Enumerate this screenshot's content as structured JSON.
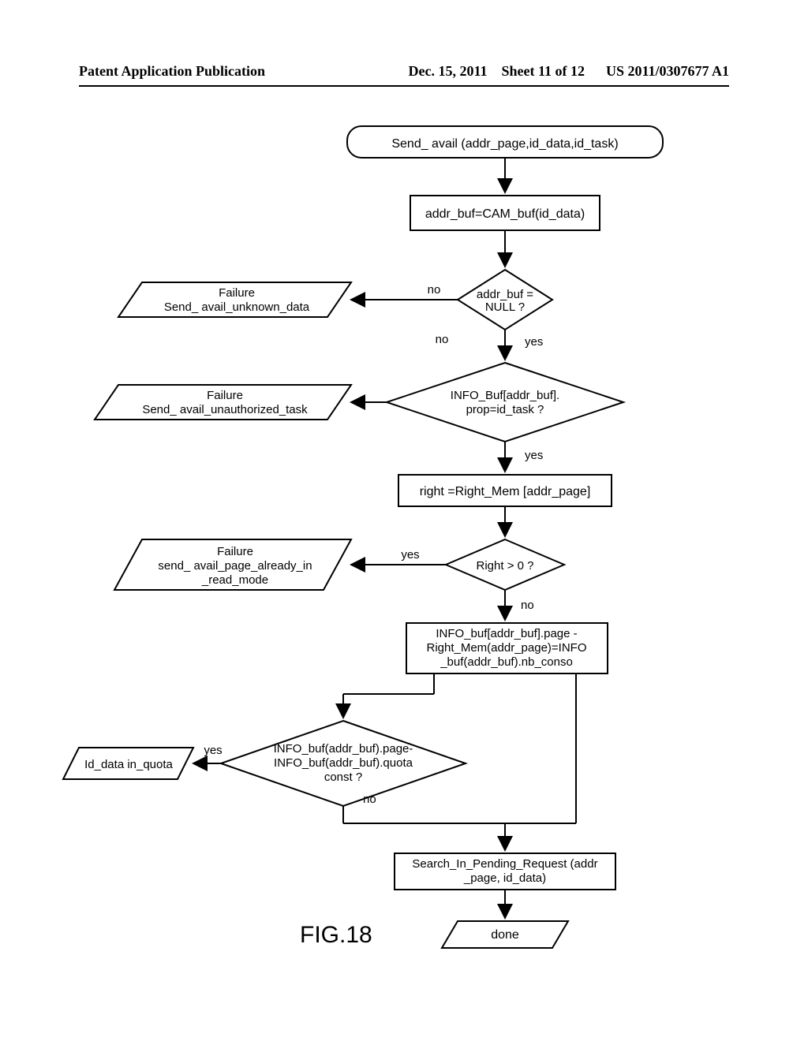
{
  "header": {
    "left": "Patent Application Publication",
    "date": "Dec. 15, 2011",
    "sheet": "Sheet 11 of 12",
    "pubno": "US 2011/0307677 A1"
  },
  "figure_label": "FIG.18",
  "flow": {
    "terminator": "Send_ avail (addr_page,id_data,id_task)",
    "proc1": "addr_buf=CAM_buf(id_data)",
    "dec1_line1": "addr_buf =",
    "dec1_line2": "NULL ?",
    "dec1_no": "no",
    "dec1_yes": "yes",
    "dec1_upno": "no",
    "fail1_line1": "Failure",
    "fail1_line2": "Send_ avail_unknown_data",
    "dec2_line1": "INFO_Buf[addr_buf].",
    "dec2_line2": "prop=id_task ?",
    "dec2_yes": "yes",
    "fail2_line1": "Failure",
    "fail2_line2": "Send_ avail_unauthorized_task",
    "proc2": "right =Right_Mem [addr_page]",
    "dec3": "Right > 0 ?",
    "dec3_yes": "yes",
    "dec3_no": "no",
    "fail3_line1": "Failure",
    "fail3_line2": "send_ avail_page_already_in",
    "fail3_line3": "_read_mode",
    "proc3_line1": "INFO_buf[addr_buf].page -",
    "proc3_line2": "Right_Mem(addr_page)=INFO",
    "proc3_line3": "_buf(addr_buf).nb_conso",
    "dec4_line1": "INFO_buf(addr_buf).page-",
    "dec4_line2": "INFO_buf(addr_buf).quota",
    "dec4_line3": "const ?",
    "dec4_yes": "yes",
    "dec4_no": "no",
    "quota": "Id_data in_quota",
    "proc4_line1": "Search_In_Pending_Request (addr",
    "proc4_line2": "_page, id_data)",
    "done": "done"
  }
}
